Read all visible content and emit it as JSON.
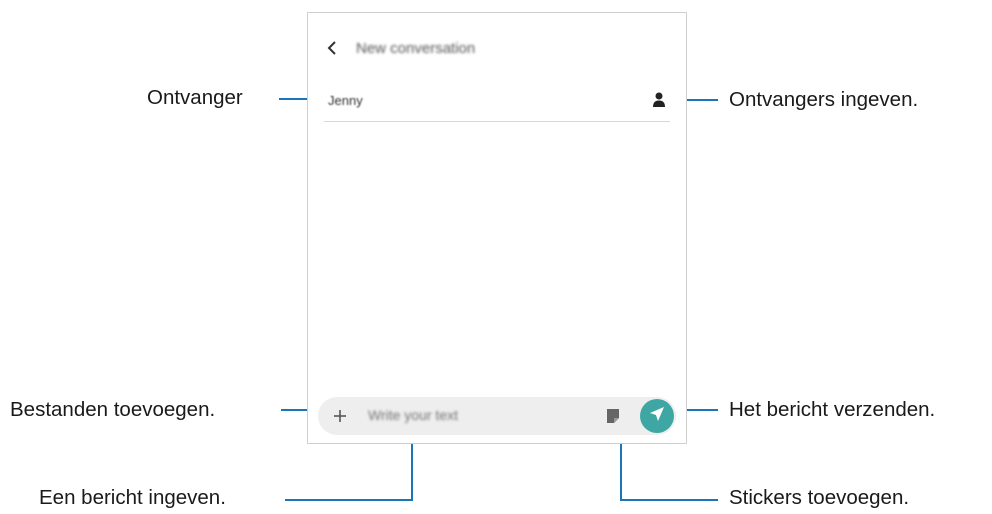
{
  "screen": {
    "title": "New conversation",
    "recipient": "Jenny",
    "message_placeholder": "Write your text"
  },
  "callouts": {
    "recipient": "Ontvanger",
    "add_recipients": "Ontvangers ingeven.",
    "add_files": "Bestanden toevoegen.",
    "send_message": "Het bericht verzenden.",
    "enter_message": "Een bericht ingeven.",
    "add_stickers": "Stickers toevoegen."
  },
  "colors": {
    "leader_line": "#1b75bb",
    "send_button": "#3fa7a3"
  },
  "icons": [
    "back-arrow-icon",
    "contact-icon",
    "add-icon",
    "sticker-icon",
    "send-icon"
  ]
}
